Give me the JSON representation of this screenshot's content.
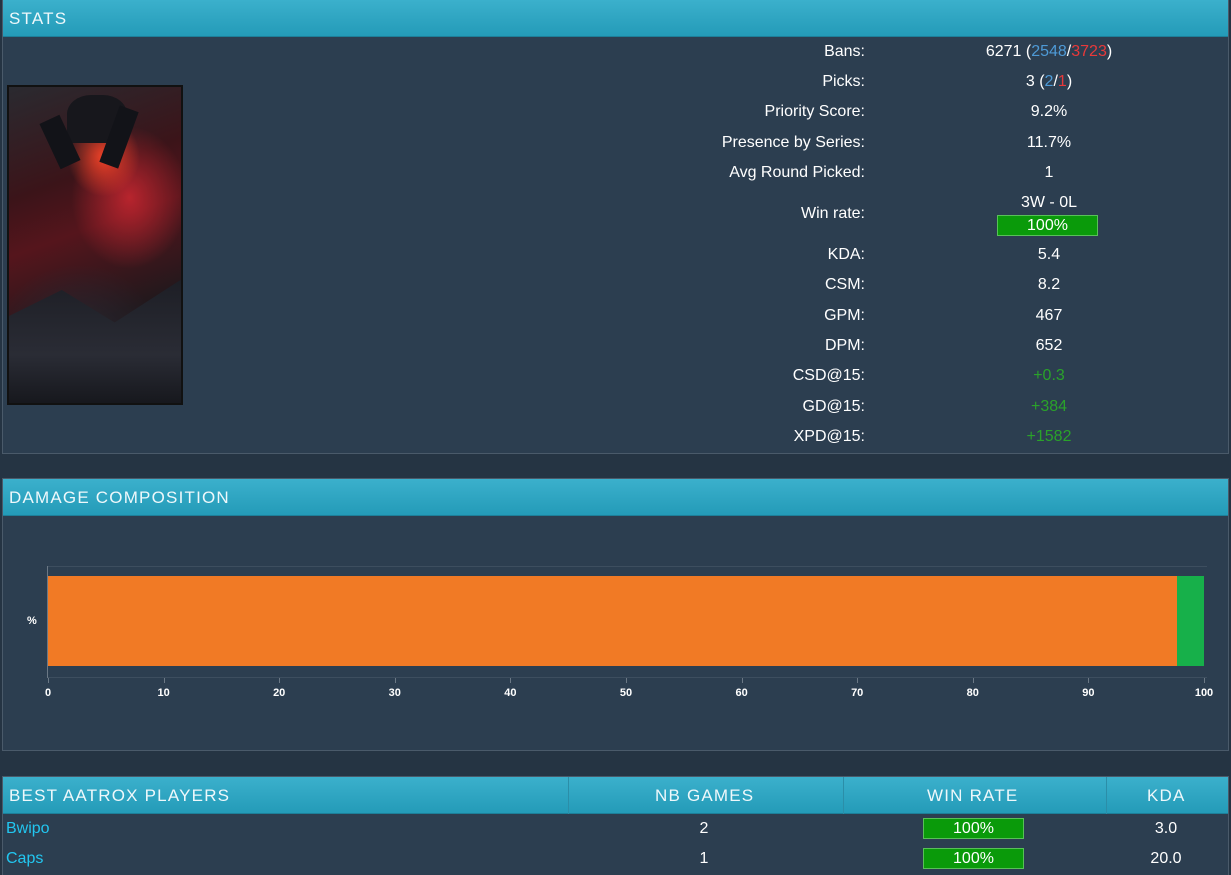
{
  "stats": {
    "title": "STATS",
    "bans": {
      "label": "Bans:",
      "total": "6271",
      "blue": "2548",
      "red": "3723"
    },
    "picks": {
      "label": "Picks:",
      "total": "3",
      "blue": "2",
      "red": "1"
    },
    "rows": [
      {
        "label": "Priority Score:",
        "value": "9.2%"
      },
      {
        "label": "Presence by Series:",
        "value": "11.7%"
      },
      {
        "label": "Avg Round Picked:",
        "value": "1"
      }
    ],
    "winrate": {
      "label": "Win rate:",
      "record": "3W - 0L",
      "percent": "100%"
    },
    "rows2": [
      {
        "label": "KDA:",
        "value": "5.4"
      },
      {
        "label": "CSM:",
        "value": "8.2"
      },
      {
        "label": "GPM:",
        "value": "467"
      },
      {
        "label": "DPM:",
        "value": "652"
      },
      {
        "label": "CSD@15:",
        "value": "+0.3"
      },
      {
        "label": "GD@15:",
        "value": "+384"
      },
      {
        "label": "XPD@15:",
        "value": "+1582"
      }
    ]
  },
  "damage": {
    "title": "DAMAGE COMPOSITION",
    "axis_label": "%",
    "ticks": [
      "0",
      "10",
      "20",
      "30",
      "40",
      "50",
      "60",
      "70",
      "80",
      "90",
      "100"
    ]
  },
  "chart_data": {
    "type": "bar",
    "orientation": "horizontal-stacked",
    "categories": [
      "%"
    ],
    "series": [
      {
        "values": [
          97.7
        ],
        "color": "#f17a25"
      },
      {
        "values": [
          2.3
        ],
        "color": "#17b04a"
      }
    ],
    "xlim": [
      0,
      100
    ]
  },
  "players": {
    "title": "BEST AATROX PLAYERS",
    "col_games": "NB GAMES",
    "col_winrate": "WIN RATE",
    "col_kda": "KDA",
    "rows": [
      {
        "name": "Bwipo",
        "games": "2",
        "winrate": "100%",
        "kda": "3.0"
      },
      {
        "name": "Caps",
        "games": "1",
        "winrate": "100%",
        "kda": "20.0"
      }
    ]
  },
  "colors": {
    "header": "#249bb8",
    "panel": "#2c3e50",
    "win": "#0a9a0a",
    "blue": "#4e9ad6",
    "red": "#e8393a",
    "link": "#22c6f0"
  }
}
